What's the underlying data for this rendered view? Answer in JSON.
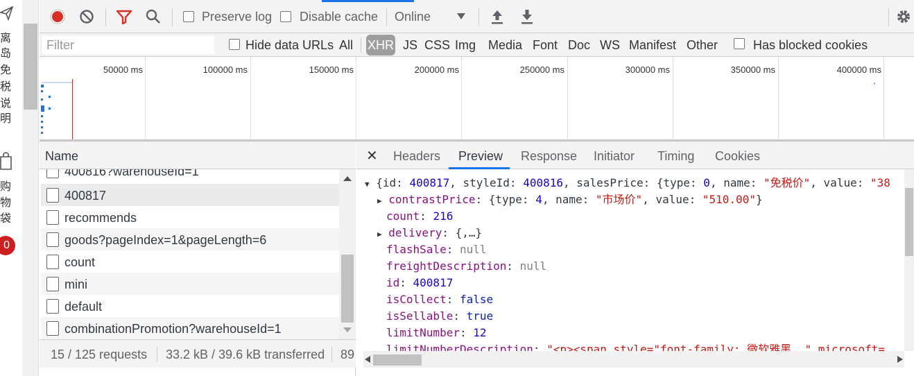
{
  "page_strip": {
    "chars": [
      "离",
      "岛",
      "免",
      "税",
      "说",
      "明"
    ],
    "cart_chars": [
      "购",
      "物",
      "袋"
    ],
    "cart_count": "0"
  },
  "toolbar": {
    "preserve_log": "Preserve log",
    "disable_cache": "Disable cache",
    "throttle": "Online"
  },
  "filter": {
    "placeholder": "Filter",
    "hide_data_urls": "Hide data URLs",
    "types": [
      "All",
      "XHR",
      "JS",
      "CSS",
      "Img",
      "Media",
      "Font",
      "Doc",
      "WS",
      "Manifest",
      "Other"
    ],
    "active_type": "XHR",
    "has_blocked_cookies": "Has blocked cookies"
  },
  "overview": {
    "ticks": [
      "50000 ms",
      "100000 ms",
      "150000 ms",
      "200000 ms",
      "250000 ms",
      "300000 ms",
      "350000 ms",
      "400000 ms"
    ]
  },
  "requests": {
    "header": "Name",
    "rows": [
      "400816?warehouseId=1",
      "400817",
      "recommends",
      "goods?pageIndex=1&pageLength=6",
      "count",
      "mini",
      "default",
      "combinationPromotion?warehouseId=1"
    ],
    "selected_index": 1
  },
  "status": {
    "requests": "15 / 125 requests",
    "transferred": "33.2 kB / 39.6 kB transferred",
    "more": "89"
  },
  "detail": {
    "tabs": [
      "Headers",
      "Preview",
      "Response",
      "Initiator",
      "Timing",
      "Cookies"
    ],
    "active_tab": "Preview",
    "summary": {
      "prefix": "{id: ",
      "id": "400817",
      "mid1": ", styleId: ",
      "styleId": "400816",
      "mid2": ", salesPrice: {type: ",
      "type": "0",
      "mid3": ", name: ",
      "name": "\"免税价\"",
      "mid4": ", value: ",
      "value": "\"38"
    },
    "contrast_price": {
      "key": "contrastPrice",
      "pre": ": {type: ",
      "type": "4",
      "mid": ", name: ",
      "name": "\"市场价\"",
      "mid2": ", value: ",
      "value": "\"510.00\"",
      "close": "}"
    },
    "fields": [
      {
        "key": "count",
        "value": "216",
        "kind": "num"
      },
      {
        "key": "delivery",
        "value": "{,…}",
        "kind": "obj"
      },
      {
        "key": "flashSale",
        "value": "null",
        "kind": "nul"
      },
      {
        "key": "freightDescription",
        "value": "null",
        "kind": "nul"
      },
      {
        "key": "id",
        "value": "400817",
        "kind": "num"
      },
      {
        "key": "isCollect",
        "value": "false",
        "kind": "kw"
      },
      {
        "key": "isSellable",
        "value": "true",
        "kind": "kw"
      },
      {
        "key": "limitNumber",
        "value": "12",
        "kind": "num"
      },
      {
        "key": "limitNumberDescription",
        "value": "\"<p><span style=\"font-family: 微软雅黑, \" microsoft=",
        "kind": "str"
      }
    ]
  }
}
